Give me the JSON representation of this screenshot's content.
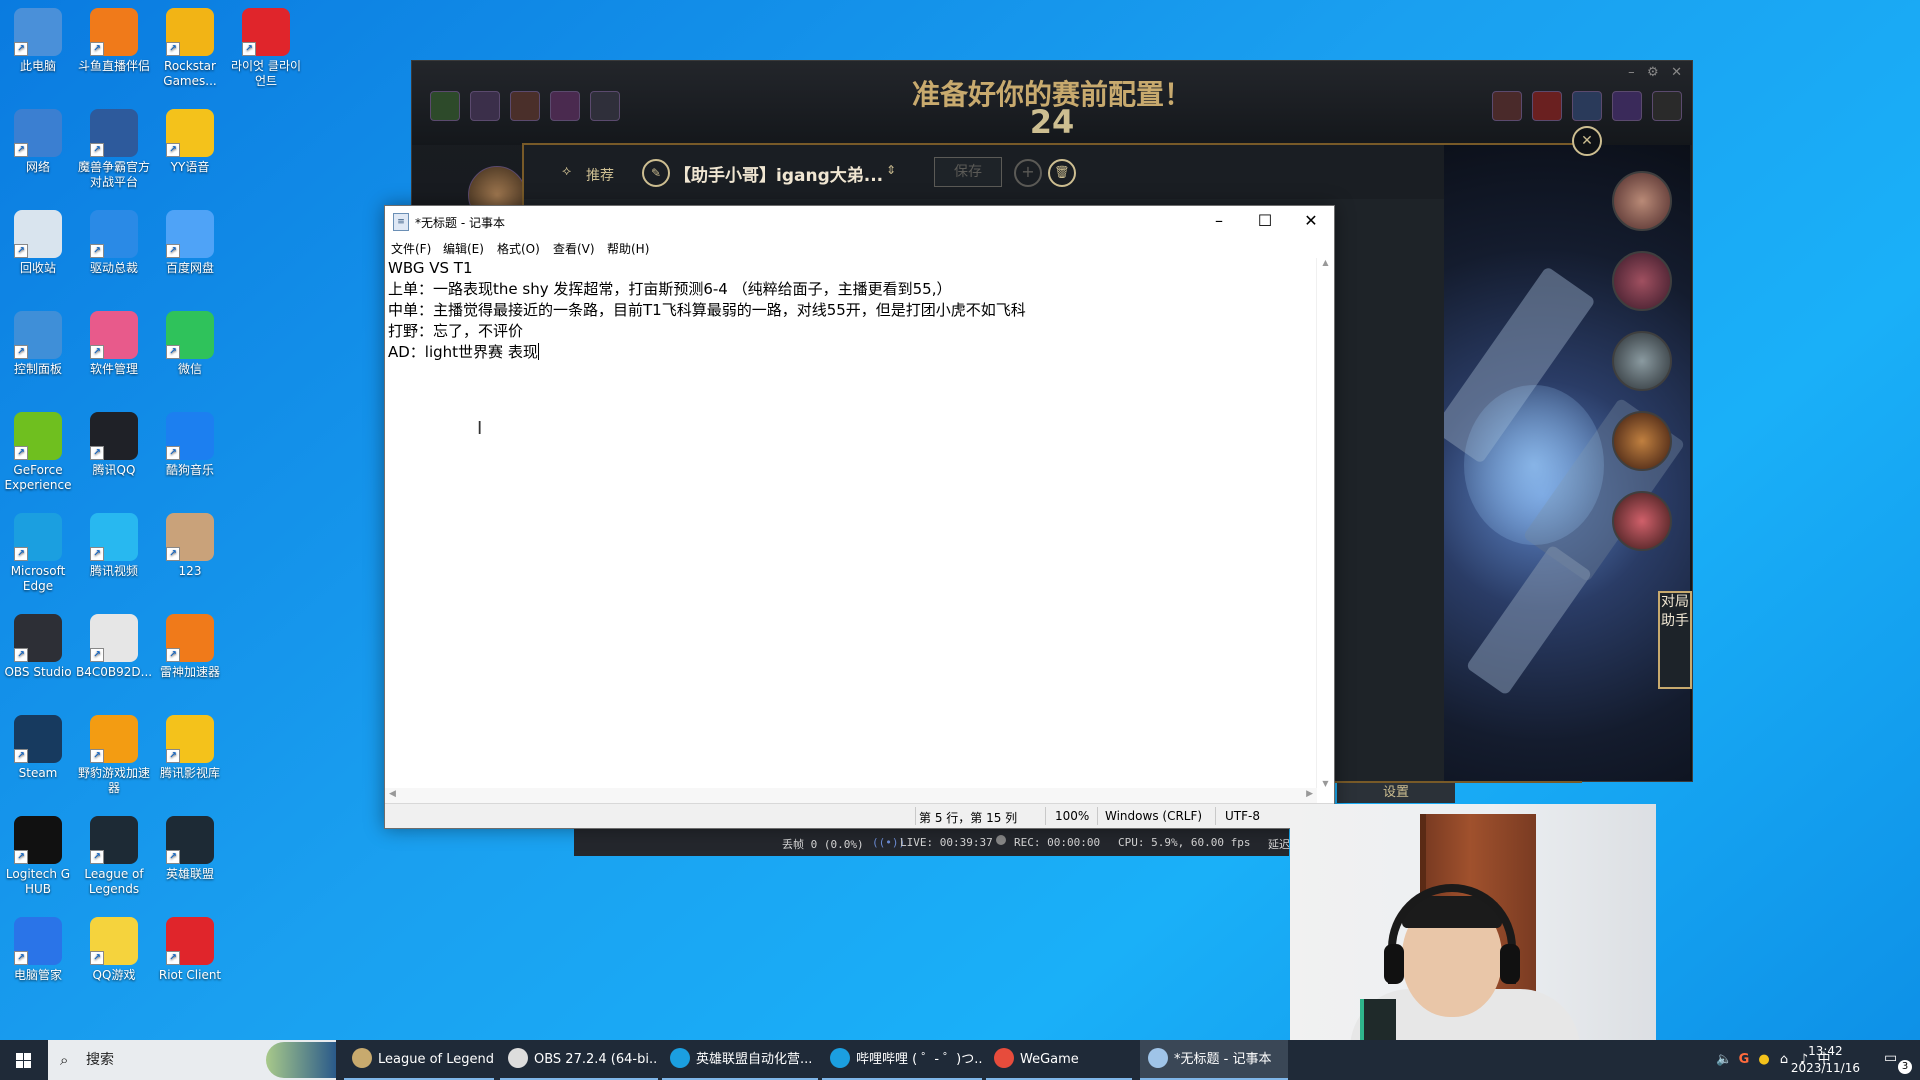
{
  "desktop": {
    "icons": [
      {
        "label": "此电脑",
        "color": "#4a90d9"
      },
      {
        "label": "斗鱼直播伴侣",
        "color": "#f07a1a"
      },
      {
        "label": "Rockstar Games...",
        "color": "#f2b415"
      },
      {
        "label": "라이엇 클라이언트",
        "color": "#e0252b"
      },
      {
        "label": "网络",
        "color": "#3b7fd1"
      },
      {
        "label": "魔兽争霸官方对战平台",
        "color": "#2d5a9c"
      },
      {
        "label": "YY语音",
        "color": "#f4c21b"
      },
      {
        "label": "回收站",
        "color": "#d9e4ee"
      },
      {
        "label": "驱动总裁",
        "color": "#2a8ae6"
      },
      {
        "label": "百度网盘",
        "color": "#4fa3f7"
      },
      {
        "label": "控制面板",
        "color": "#3f8fd8"
      },
      {
        "label": "软件管理",
        "color": "#e85a8b"
      },
      {
        "label": "微信",
        "color": "#2fc25b"
      },
      {
        "label": "GeForce Experience",
        "color": "#6fbf1f"
      },
      {
        "label": "腾讯QQ",
        "color": "#1f2127"
      },
      {
        "label": "酷狗音乐",
        "color": "#1c7ff0"
      },
      {
        "label": "Microsoft Edge",
        "color": "#1b9fe0"
      },
      {
        "label": "腾讯视频",
        "color": "#28b8f0"
      },
      {
        "label": "123",
        "color": "#c9a27a"
      },
      {
        "label": "OBS Studio",
        "color": "#2d2f36"
      },
      {
        "label": "B4C0B92D...",
        "color": "#e6e6e6"
      },
      {
        "label": "雷神加速器",
        "color": "#f07a1a"
      },
      {
        "label": "Steam",
        "color": "#173a5f"
      },
      {
        "label": "野豹游戏加速器",
        "color": "#f39c12"
      },
      {
        "label": "腾讯影视库",
        "color": "#f4c21b"
      },
      {
        "label": "Logitech G HUB",
        "color": "#111111"
      },
      {
        "label": "League of Legends",
        "color": "#1d2a35"
      },
      {
        "label": "英雄联盟",
        "color": "#1d2a35"
      },
      {
        "label": "电脑管家",
        "color": "#2a74e8"
      },
      {
        "label": "QQ游戏",
        "color": "#f5d33d"
      },
      {
        "label": "Riot Client",
        "color": "#e0252b"
      }
    ]
  },
  "lol_client": {
    "title": "准备好你的赛前配置！",
    "timer": "24",
    "panel": {
      "recommend_label": "推荐",
      "page_name": "【助手小哥】igang大弟...",
      "save_label": "保存",
      "add_symbol": "+",
      "delete_symbol": "🗑"
    },
    "close_symbol": "✕",
    "side_tab_label": "对局助手",
    "settings_label": "设置"
  },
  "notepad": {
    "title": "*无标题 - 记事本",
    "menu": [
      "文件(F)",
      "编辑(E)",
      "格式(O)",
      "查看(V)",
      "帮助(H)"
    ],
    "lines": [
      "WBG VS T1",
      "上单：一路表现the shy 发挥超常，打亩斯预测6-4 （纯粹给面子，主播更看到55,）",
      "中单：主播觉得最接近的一条路，目前T1飞科算最弱的一路，对线55开，但是打团小虎不如飞科",
      "打野：忘了，不评价",
      "AD：light世界赛 表现"
    ],
    "status": {
      "position": "第 5 行，第 15 列",
      "zoom": "100%",
      "line_ending": "Windows (CRLF)",
      "encoding": "UTF-8"
    }
  },
  "obs_status": {
    "dropped": "丢帧 0 (0.0%)",
    "live": "LIVE: 00:39:37",
    "rec": "REC: 00:00:00",
    "cpu": "CPU: 5.9%, 60.00 fps",
    "latency": "延迟"
  },
  "taskbar": {
    "search_placeholder": "搜索",
    "items": [
      {
        "label": "League of Legends",
        "color": "#c8aa6e"
      },
      {
        "label": "OBS 27.2.4 (64-bi...",
        "color": "#dddddd"
      },
      {
        "label": "英雄联盟自动化营...",
        "color": "#1b9fe0"
      },
      {
        "label": "哔哩哔哩 ( ゜- ゜)つ...",
        "color": "#1b9fe0"
      },
      {
        "label": "WeGame",
        "color": "#e74c3c"
      },
      {
        "label": "*无标题 - 记事本",
        "color": "#9fc4e8"
      }
    ],
    "tray": {
      "ime": "中",
      "time": "13:42",
      "date": "2023/11/16",
      "notif_count": "3"
    }
  }
}
